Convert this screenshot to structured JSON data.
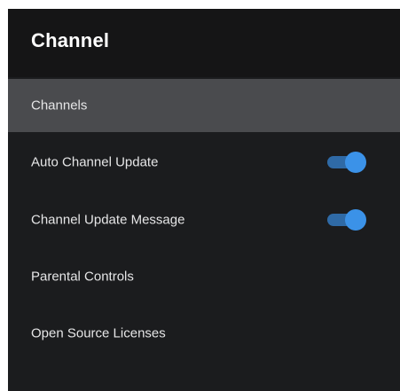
{
  "panel": {
    "title": "Channel"
  },
  "menu": {
    "items": [
      {
        "label": "Channels",
        "selected": true
      },
      {
        "label": "Auto Channel Update",
        "toggle": true,
        "state": "on"
      },
      {
        "label": "Channel Update Message",
        "toggle": true,
        "state": "on"
      },
      {
        "label": "Parental Controls"
      },
      {
        "label": "Open Source Licenses"
      }
    ]
  },
  "colors": {
    "background": "#1b1c1e",
    "header": "#151516",
    "selected_row": "#4a4b4e",
    "toggle_accent": "#3b92e8"
  }
}
